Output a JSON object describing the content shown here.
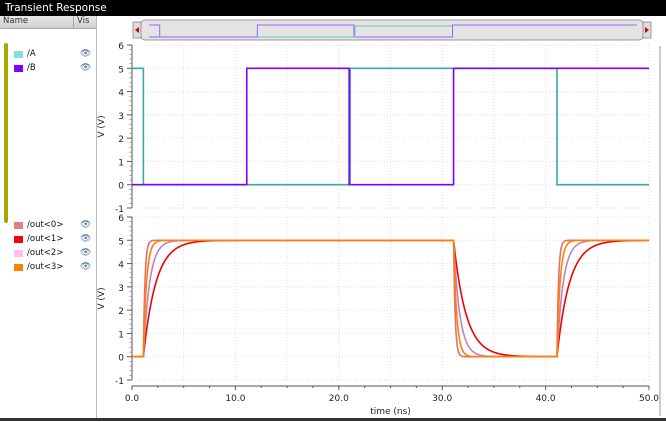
{
  "window": {
    "title": "Transient Response"
  },
  "panel": {
    "name_header": "Name",
    "vis_header": "Vis",
    "groups": [
      {
        "items": [
          {
            "label": "/A",
            "color": "#80e0e0"
          },
          {
            "label": "/B",
            "color": "#8000ff"
          }
        ]
      },
      {
        "items": [
          {
            "label": "/out<0>",
            "color": "#e08080"
          },
          {
            "label": "/out<1>",
            "color": "#ff0000"
          },
          {
            "label": "/out<2>",
            "color": "#ffc0f0"
          },
          {
            "label": "/out<3>",
            "color": "#ff8000"
          }
        ]
      }
    ]
  },
  "chart_data": [
    {
      "type": "line",
      "ylabel": "V (V)",
      "ylim": [
        -1,
        6
      ],
      "yticks": [
        "6",
        "5",
        "4",
        "3",
        "2",
        "1",
        "0",
        "-1"
      ],
      "series": [
        {
          "name": "/A",
          "color": "#3aa8a8",
          "edges": [
            [
              0,
              5
            ],
            [
              1.1,
              0
            ],
            [
              21.1,
              5
            ],
            [
              41.1,
              0
            ]
          ]
        },
        {
          "name": "/B",
          "color": "#8000ff",
          "edges": [
            [
              0,
              0
            ],
            [
              11.1,
              5
            ],
            [
              21.0,
              0
            ],
            [
              31.1,
              5
            ]
          ]
        }
      ]
    },
    {
      "type": "line",
      "ylabel": "V (V)",
      "ylim": [
        -1,
        6
      ],
      "yticks": [
        "6",
        "5",
        "4",
        "3",
        "2",
        "1",
        "0",
        "-1"
      ],
      "series": [
        {
          "name": "/out<0>",
          "color": "#e07070",
          "tau": 0.15
        },
        {
          "name": "/out<1>",
          "color": "#ee0000",
          "tau": 1.2
        },
        {
          "name": "/out<2>",
          "color": "#c080c0",
          "tau": 0.6
        },
        {
          "name": "/out<3>",
          "color": "#ff8000",
          "tau": 0.3
        }
      ],
      "transitions": [
        [
          0,
          0
        ],
        [
          1.1,
          5
        ],
        [
          31.1,
          0
        ],
        [
          41.1,
          5
        ]
      ]
    }
  ],
  "xaxis": {
    "label": "time (ns)",
    "xlim": [
      0,
      50
    ],
    "ticks": [
      "0.0",
      "10.0",
      "20.0",
      "30.0",
      "40.0",
      "50.0"
    ]
  }
}
